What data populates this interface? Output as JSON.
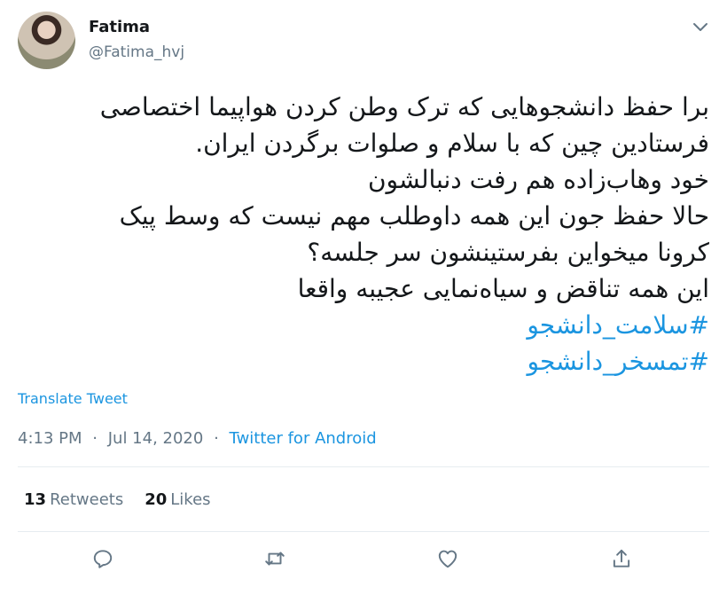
{
  "author": {
    "name": "Fatima",
    "handle": "@Fatima_hvj"
  },
  "tweet": {
    "lines": [
      "برا حفظ دانشجوهایی که ترک وطن کردن هواپیما اختصاصی",
      "فرستادین چین که با سلام و صلوات برگردن ایران.",
      "خود وهاب‌زاده هم رفت دنبالشون",
      "حالا حفظ جون این همه داوطلب مهم نیست که وسط پیک",
      "کرونا میخواین بفرستینشون سر جلسه؟",
      "این همه تناقض و سیاه‌نمایی عجیبه واقعا"
    ],
    "hashtags": [
      "#سلامت_دانشجو",
      "#تمسخر_دانشجو"
    ],
    "translate_label": "Translate Tweet",
    "time": "4:13 PM",
    "separator": "·",
    "date": "Jul 14, 2020",
    "source": "Twitter for Android"
  },
  "stats": {
    "retweets_count": "13",
    "retweets_label": "Retweets",
    "likes_count": "20",
    "likes_label": "Likes"
  },
  "colors": {
    "link": "#1b95e0",
    "secondary_text": "#657786",
    "primary_text": "#14171a",
    "divider": "#e6ecf0"
  },
  "icons": {
    "more": "chevron-down-icon",
    "reply": "reply-icon",
    "retweet": "retweet-icon",
    "like": "like-icon",
    "share": "share-icon"
  }
}
